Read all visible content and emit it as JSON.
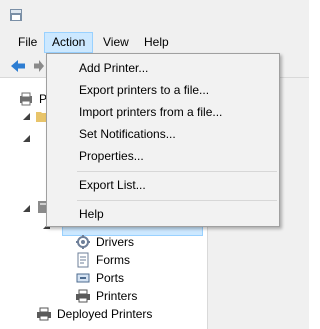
{
  "menubar": {
    "items": [
      {
        "label": "File"
      },
      {
        "label": "Action"
      },
      {
        "label": "View"
      },
      {
        "label": "Help"
      }
    ]
  },
  "action_menu": {
    "items": [
      {
        "label": "Add Printer..."
      },
      {
        "label": "Export printers to a file..."
      },
      {
        "label": "Import printers from a file..."
      },
      {
        "label": "Set Notifications..."
      },
      {
        "label": "Properties..."
      },
      {
        "label": "Export List..."
      },
      {
        "label": "Help"
      }
    ]
  },
  "tree": {
    "root_label": "P",
    "server_label": "...",
    "children": [
      {
        "label": "Drivers"
      },
      {
        "label": "Forms"
      },
      {
        "label": "Ports"
      },
      {
        "label": "Printers"
      }
    ],
    "deployed_label": "Deployed Printers"
  },
  "colors": {
    "menu_highlight": "#cce8ff",
    "menu_highlight_border": "#99d1ff",
    "menu_background": "#f2f2f2",
    "chrome_background": "#f0f0f0"
  }
}
